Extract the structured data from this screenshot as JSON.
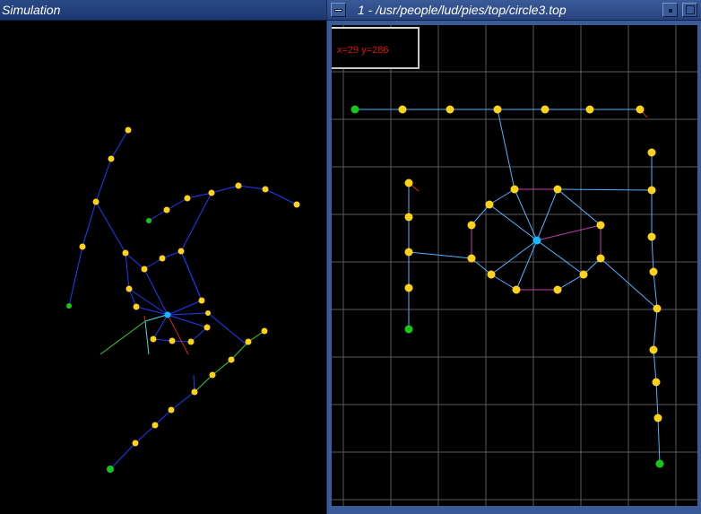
{
  "left_window": {
    "title": "Simulation"
  },
  "right_window": {
    "title": "1 - /usr/people/lud/pies/top/circle3.top"
  },
  "coord_readout": "x=29 y=286",
  "colors": {
    "node": "#ffd21a",
    "anchor_node": "#18c818",
    "hub_node": "#19b7ff",
    "left_edge": "#1a3cff",
    "right_edge": "#4fb3ff",
    "ring_edge": "#c040b0",
    "grid": "#5a5a5a",
    "force_red": "#e02020",
    "force_green": "#30d030",
    "force_cyan": "#40e0e0"
  },
  "icons": {
    "menu": "window-menu-icon",
    "minimize": "minimize-icon",
    "maximize": "maximize-icon"
  }
}
